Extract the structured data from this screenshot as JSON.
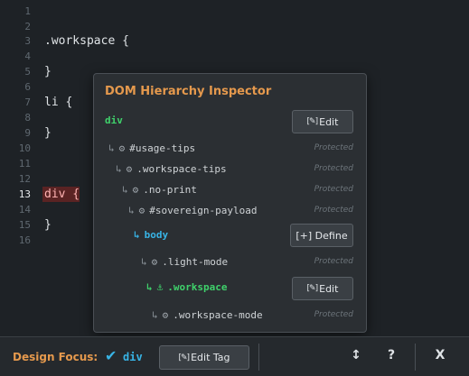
{
  "editor": {
    "lines": [
      {
        "num": "1",
        "code": ""
      },
      {
        "num": "2",
        "code": ""
      },
      {
        "num": "3",
        "code": ".workspace {"
      },
      {
        "num": "4",
        "code": ""
      },
      {
        "num": "5",
        "code": "}"
      },
      {
        "num": "6",
        "code": ""
      },
      {
        "num": "7",
        "code": "li {"
      },
      {
        "num": "8",
        "code": ""
      },
      {
        "num": "9",
        "code": "}"
      },
      {
        "num": "10",
        "code": ""
      },
      {
        "num": "11",
        "code": ""
      },
      {
        "num": "12",
        "code": ""
      },
      {
        "num": "13",
        "code": "div {"
      },
      {
        "num": "14",
        "code": ""
      },
      {
        "num": "15",
        "code": "}"
      },
      {
        "num": "16",
        "code": ""
      }
    ],
    "active_line": "13",
    "highlight_color": "#5a2323"
  },
  "inspector": {
    "title": "DOM Hierarchy Inspector",
    "root": {
      "tag": "div",
      "button_label": "Edit",
      "button_icon": "pencil-icon"
    },
    "rows": [
      {
        "arrow": "↳",
        "icon": "⚙",
        "label": "#usage-tips",
        "status": "Protected"
      },
      {
        "arrow": "↳",
        "icon": "⚙",
        "label": ".workspace-tips",
        "status": "Protected"
      },
      {
        "arrow": "↳",
        "icon": "⚙",
        "label": ".no-print",
        "status": "Protected"
      },
      {
        "arrow": "↳",
        "icon": "⚙",
        "label": "#sovereign-payload",
        "status": "Protected"
      },
      {
        "arrow": "↳",
        "label": "body",
        "button_label": "[+] Define"
      },
      {
        "arrow": "↳",
        "icon": "⚙",
        "label": ".light-mode",
        "status": "Protected"
      },
      {
        "arrow": "↳",
        "icon": "⚓",
        "label": ".workspace",
        "button_label": "Edit",
        "button_icon": "pencil-icon"
      },
      {
        "arrow": "↳",
        "icon": "⚙",
        "label": ".workspace-mode",
        "status": "Protected"
      }
    ]
  },
  "bottombar": {
    "focus_label": "Design Focus:",
    "focus_check": "✔",
    "focus_tag": "div",
    "edit_tag_label": "Edit Tag",
    "resize_icon": "↕",
    "help_label": "?",
    "close_label": "X"
  },
  "colors": {
    "accent_orange": "#e5994d",
    "tag_green": "#3fd16b",
    "tag_blue": "#38b4e6",
    "background": "#1e2226",
    "panel": "#2b2f33"
  }
}
